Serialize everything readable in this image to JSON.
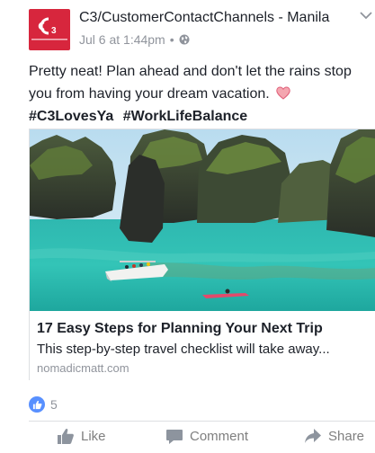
{
  "post": {
    "page_name": "C3/CustomerContactChannels - Manila",
    "timestamp": "Jul 6 at 1:44pm",
    "separator": "•",
    "privacy_icon": "globe-icon",
    "menu_icon": "chevron-down-icon",
    "body_text": "Pretty neat! Plan ahead and don't let the rains stop you from having your dream vacation.",
    "hashtags": [
      "#C3LovesYa",
      "#WorkLifeBalance"
    ]
  },
  "link_preview": {
    "title": "17 Easy Steps for Planning Your Next Trip",
    "description": "This step-by-step travel checklist will take away...",
    "domain": "nomadicmatt.com"
  },
  "reactions": {
    "icon": "like-reaction-icon",
    "count": "5"
  },
  "actions": {
    "like_label": "Like",
    "comment_label": "Comment",
    "share_label": "Share"
  },
  "colors": {
    "brand_red": "#d7263d",
    "like_blue": "#5890ff",
    "meta_gray": "#90949c",
    "text": "#1d2129",
    "divider": "#dddfe2"
  }
}
